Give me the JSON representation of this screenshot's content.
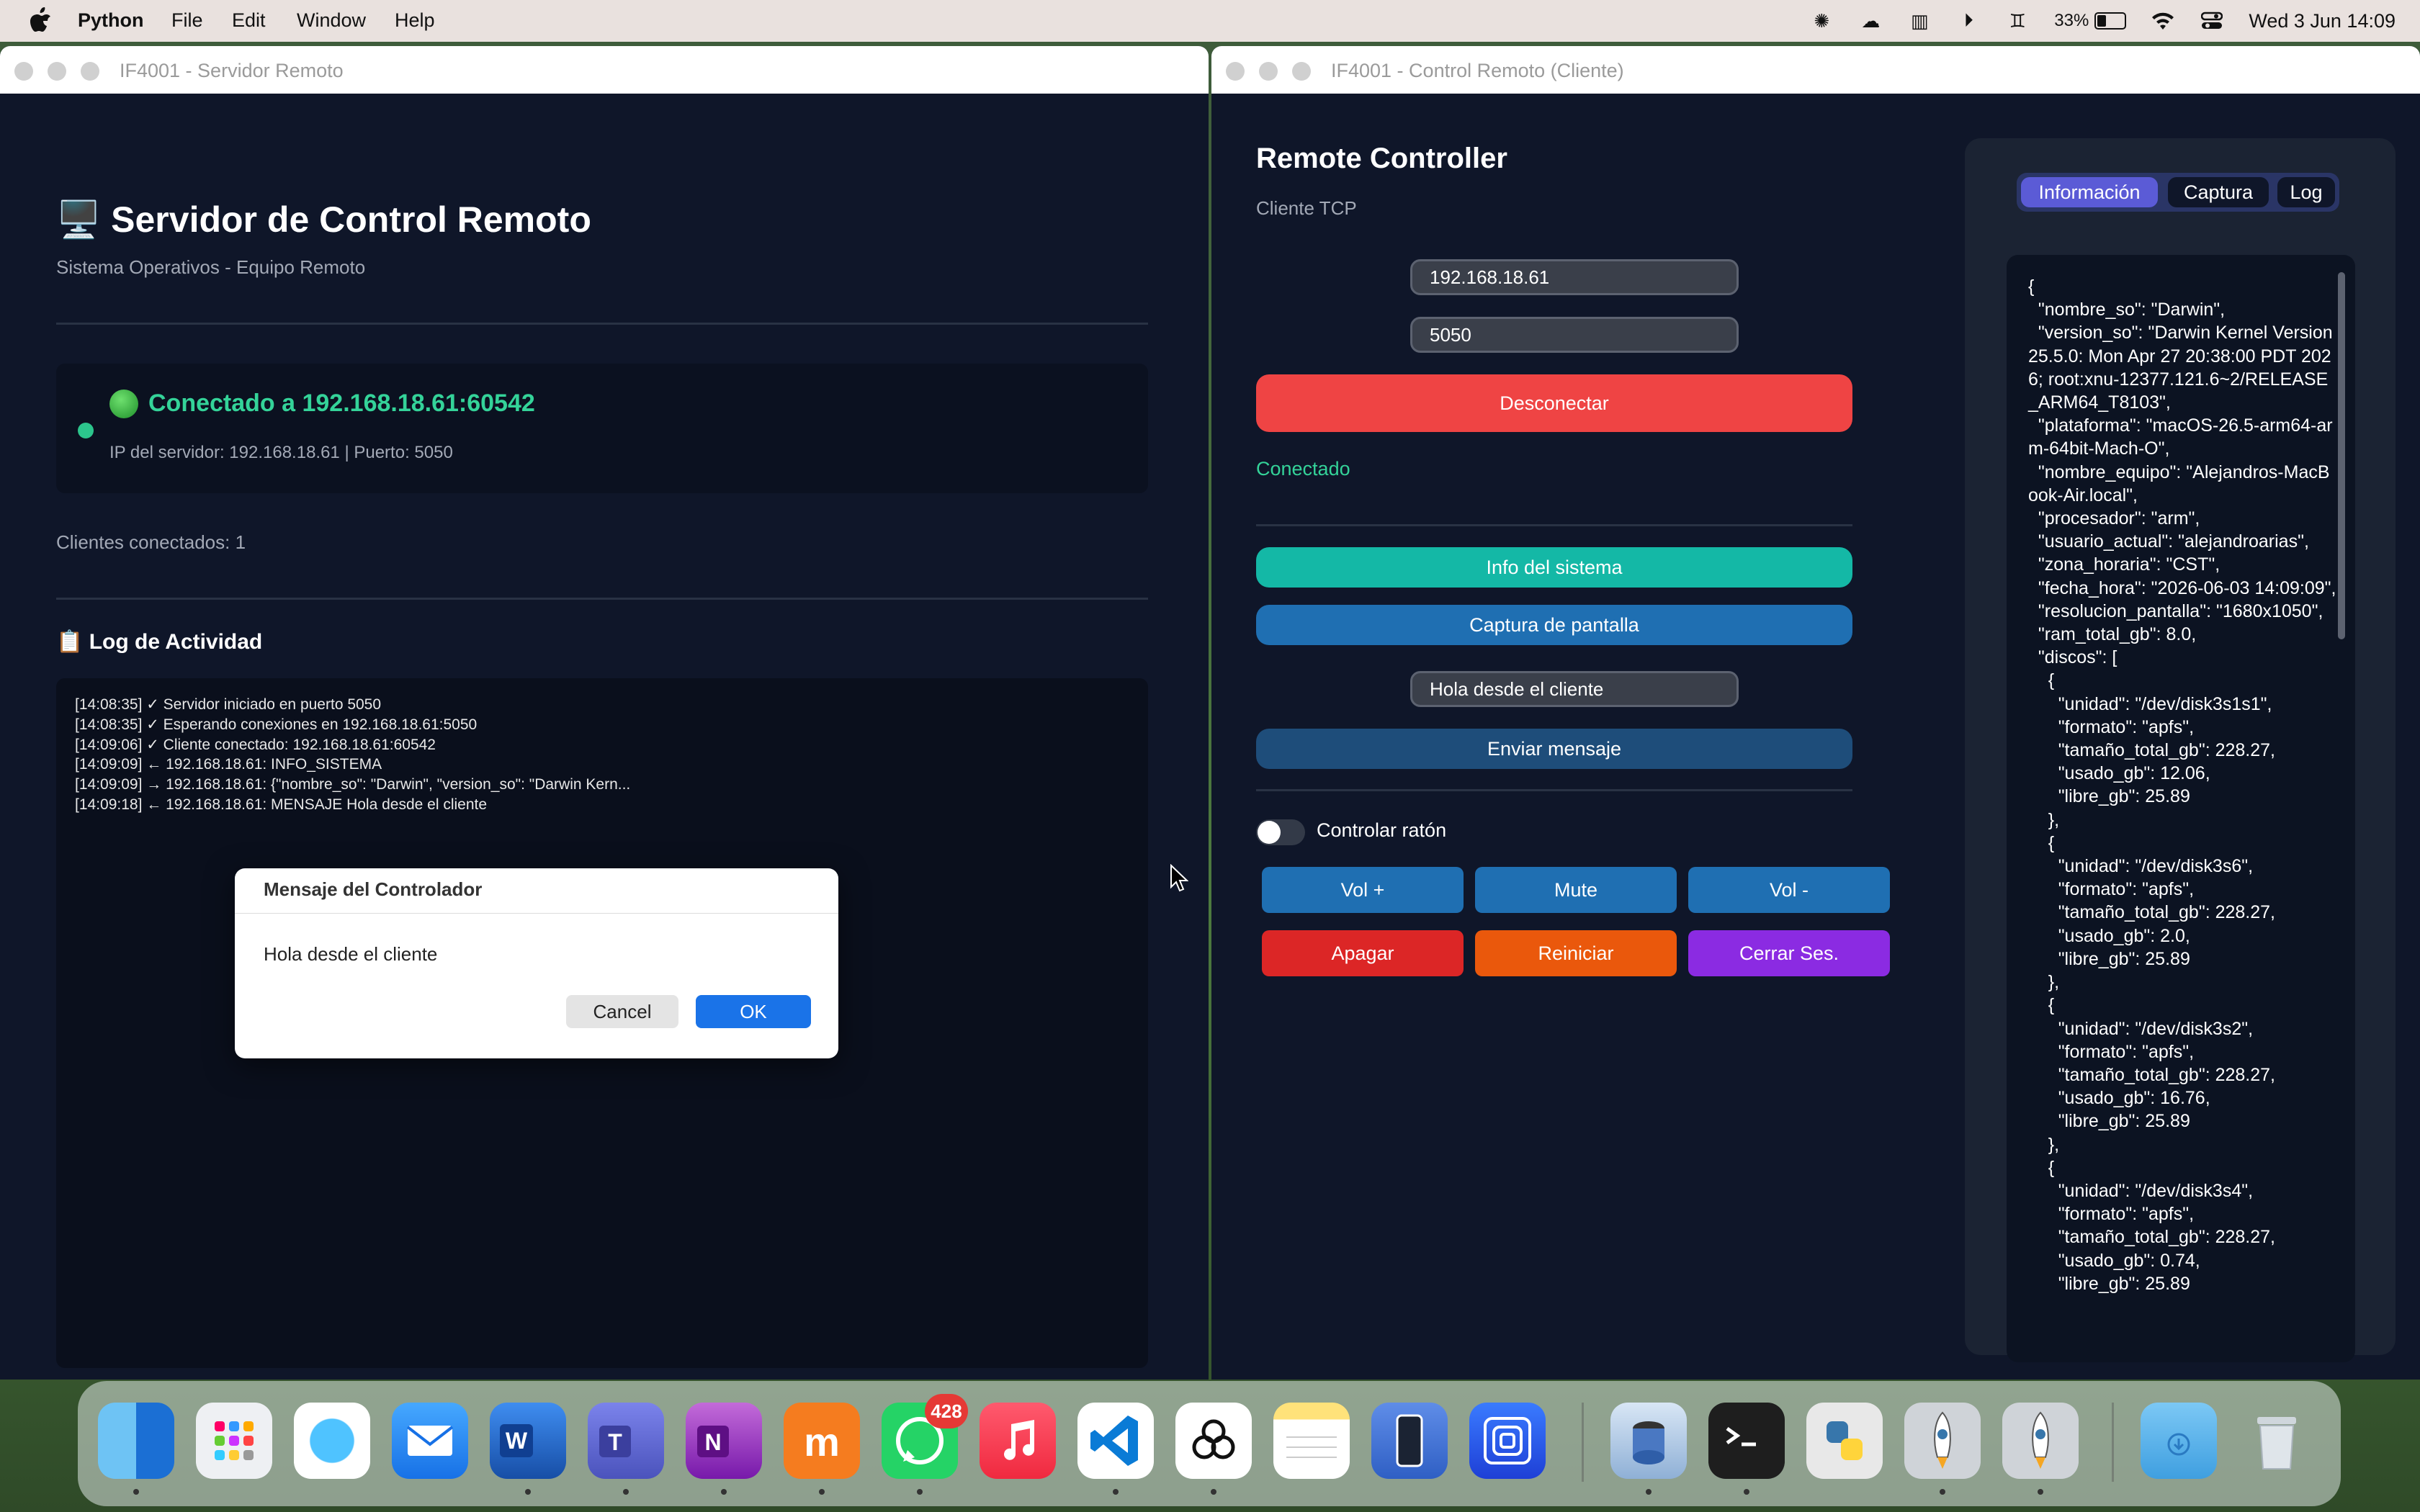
{
  "menubar": {
    "app": "Python",
    "items": [
      "File",
      "Edit",
      "Window",
      "Help"
    ],
    "battery": "33%",
    "datetime": "Wed 3 Jun  14:09"
  },
  "server": {
    "window_title": "IF4001 - Servidor Remoto",
    "title": "🖥️ Servidor de Control Remoto",
    "subtitle": "Sistema Operativos - Equipo Remoto",
    "status": "Conectado a 192.168.18.61:60542",
    "server_info": "IP del servidor: 192.168.18.61 | Puerto: 5050",
    "clients": "Clientes conectados: 1",
    "log_title": "📋 Log de Actividad",
    "log": [
      "[14:08:35] ✓ Servidor iniciado en puerto 5050",
      "[14:08:35] ✓ Esperando conexiones en 192.168.18.61:5050",
      "[14:09:06] ✓ Cliente conectado: 192.168.18.61:60542",
      "[14:09:09] ← 192.168.18.61: INFO_SISTEMA",
      "[14:09:09] → 192.168.18.61: {\"nombre_so\": \"Darwin\", \"version_so\": \"Darwin Kern...",
      "[14:09:18] ← 192.168.18.61: MENSAJE Hola desde el cliente"
    ]
  },
  "dialog": {
    "title": "Mensaje del Controlador",
    "message": "Hola desde el cliente",
    "cancel": "Cancel",
    "ok": "OK"
  },
  "client": {
    "window_title": "IF4001 - Control Remoto (Cliente)",
    "title": "Remote Controller",
    "subtitle": "Cliente TCP",
    "ip_value": "192.168.18.61",
    "port_value": "5050",
    "disconnect": "Desconectar",
    "connection_status": "Conectado",
    "info_button": "Info del sistema",
    "capture_button": "Captura de pantalla",
    "message_value": "Hola desde el cliente",
    "send_button": "Enviar mensaje",
    "mouse_toggle": "Controlar ratón",
    "vol_up": "Vol +",
    "mute": "Mute",
    "vol_down": "Vol -",
    "shutdown": "Apagar",
    "restart": "Reiniciar",
    "logout": "Cerrar Ses.",
    "tabs": [
      "Información",
      "Captura",
      "Log"
    ],
    "json_text": "{\n  \"nombre_so\": \"Darwin\",\n  \"version_so\": \"Darwin Kernel Version 25.5.0: Mon Apr 27 20:38:00 PDT 2026; root:xnu-12377.121.6~2/RELEASE_ARM64_T8103\",\n  \"plataforma\": \"macOS-26.5-arm64-arm-64bit-Mach-O\",\n  \"nombre_equipo\": \"Alejandros-MacBook-Air.local\",\n  \"procesador\": \"arm\",\n  \"usuario_actual\": \"alejandroarias\",\n  \"zona_horaria\": \"CST\",\n  \"fecha_hora\": \"2026-06-03 14:09:09\",\n  \"resolucion_pantalla\": \"1680x1050\",\n  \"ram_total_gb\": 8.0,\n  \"discos\": [\n    {\n      \"unidad\": \"/dev/disk3s1s1\",\n      \"formato\": \"apfs\",\n      \"tamaño_total_gb\": 228.27,\n      \"usado_gb\": 12.06,\n      \"libre_gb\": 25.89\n    },\n    {\n      \"unidad\": \"/dev/disk3s6\",\n      \"formato\": \"apfs\",\n      \"tamaño_total_gb\": 228.27,\n      \"usado_gb\": 2.0,\n      \"libre_gb\": 25.89\n    },\n    {\n      \"unidad\": \"/dev/disk3s2\",\n      \"formato\": \"apfs\",\n      \"tamaño_total_gb\": 228.27,\n      \"usado_gb\": 16.76,\n      \"libre_gb\": 25.89\n    },\n    {\n      \"unidad\": \"/dev/disk3s4\",\n      \"formato\": \"apfs\",\n      \"tamaño_total_gb\": 228.27,\n      \"usado_gb\": 0.74,\n      \"libre_gb\": 25.89"
  },
  "dock": {
    "whatsapp_badge": "428",
    "icons": [
      "finder-icon",
      "launchpad-icon",
      "safari-icon",
      "mail-icon",
      "word-icon",
      "teams-icon",
      "onenote-icon",
      "moodle-icon",
      "whatsapp-icon",
      "music-icon",
      "vscode-icon",
      "chatgpt-icon",
      "notes-icon",
      "simulator-icon",
      "network-icon",
      "python-launcher-icon",
      "terminal-icon",
      "python-editor-icon",
      "python-rocket-icon",
      "python-rocket-2-icon",
      "downloads-folder-icon",
      "trash-icon"
    ]
  },
  "colors": {
    "window_bg": "#0f1629",
    "accent_green": "#34d399",
    "disconnect_red": "#ef4444",
    "teal": "#14b8a6",
    "blue": "#1f6fb2",
    "purple": "#8b2be2",
    "orange": "#ea580c"
  }
}
